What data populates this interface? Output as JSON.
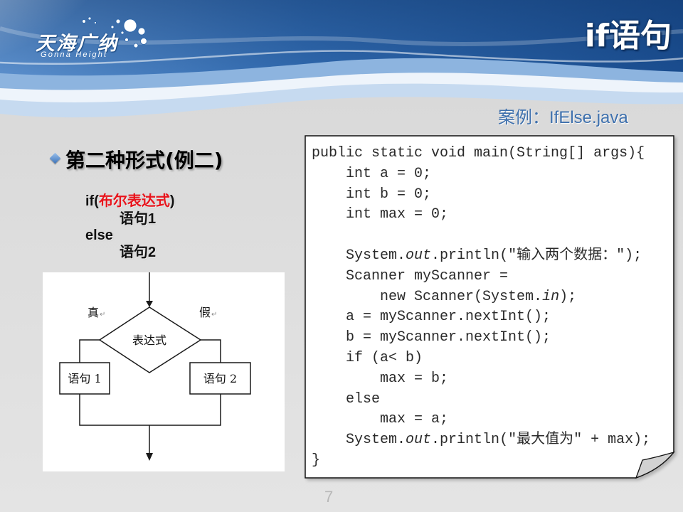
{
  "logo": {
    "name": "天海广纳",
    "tagline": "Gonna Height"
  },
  "title": "if语句",
  "subtitle": "案例：IfElse.java",
  "section": {
    "heading": "第二种形式(例二)"
  },
  "syntax": {
    "if_open": "if(",
    "condition": "布尔表达式",
    "if_close": ")",
    "statement_1": "语句1",
    "else_keyword": "else",
    "statement_2": "语句2"
  },
  "flowchart": {
    "condition": "表达式",
    "true_label": "真",
    "false_label": "假",
    "paragraph_mark": "↵",
    "statement_1": "语句 1",
    "statement_2": "语句 2"
  },
  "code": {
    "lines": [
      [
        {
          "text": "public static void main(String[] args){"
        }
      ],
      [
        {
          "text": "    int a = 0;"
        }
      ],
      [
        {
          "text": "    int b = 0;"
        }
      ],
      [
        {
          "text": "    int max = 0;"
        }
      ],
      [
        {
          "text": ""
        }
      ],
      [
        {
          "text": "    System."
        },
        {
          "text": "out",
          "italic": true
        },
        {
          "text": ".println(\"输入两个数据：\");"
        }
      ],
      [
        {
          "text": "    Scanner myScanner ="
        }
      ],
      [
        {
          "text": "        new Scanner(System."
        },
        {
          "text": "in",
          "italic": true
        },
        {
          "text": ");"
        }
      ],
      [
        {
          "text": "    a = myScanner.nextInt();"
        }
      ],
      [
        {
          "text": "    b = myScanner.nextInt();"
        }
      ],
      [
        {
          "text": "    if (a< b)"
        }
      ],
      [
        {
          "text": "        max = b;"
        }
      ],
      [
        {
          "text": "    else"
        }
      ],
      [
        {
          "text": "        max = a;"
        }
      ],
      [
        {
          "text": "    System."
        },
        {
          "text": "out",
          "italic": true
        },
        {
          "text": ".println(\"最大值为\" + max);"
        }
      ],
      [
        {
          "text": "}"
        }
      ]
    ]
  },
  "page_number": "7",
  "colors": {
    "header_dark": "#1a4d8f",
    "header_light": "#5b8fcc",
    "subtitle": "#3e70ad",
    "bullet": "#3b72b8",
    "condition": "#e8141c",
    "page_number": "#b8b8b8"
  }
}
